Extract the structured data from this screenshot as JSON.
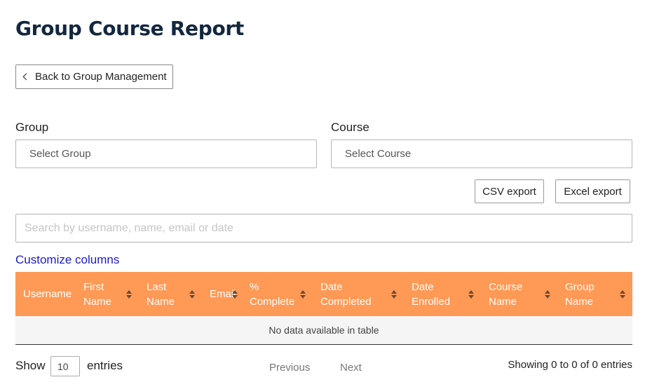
{
  "page": {
    "title": "Group Course Report"
  },
  "back_button": {
    "label": "Back to Group Management"
  },
  "filters": {
    "group": {
      "label": "Group",
      "value": "Select Group"
    },
    "course": {
      "label": "Course",
      "value": "Select Course"
    }
  },
  "exports": {
    "csv_label": "CSV export",
    "excel_label": "Excel export"
  },
  "search": {
    "placeholder": "Search by username, name, email or date"
  },
  "customize": {
    "label": "Customize columns"
  },
  "table": {
    "columns": [
      {
        "line1": "Username",
        "line2": ""
      },
      {
        "line1": "First",
        "line2": "Name"
      },
      {
        "line1": "Last",
        "line2": "Name"
      },
      {
        "line1": "Email",
        "line2": ""
      },
      {
        "line1": "%",
        "line2": "Complete"
      },
      {
        "line1": "Date",
        "line2": "Completed"
      },
      {
        "line1": "Date",
        "line2": "Enrolled"
      },
      {
        "line1": "Course",
        "line2": "Name"
      },
      {
        "line1": "Group",
        "line2": "Name"
      }
    ],
    "empty_message": "No data available in table",
    "header_color": "#ff9955"
  },
  "footer": {
    "show_label": "Show",
    "page_length": "10",
    "entries_label": "entries",
    "previous_label": "Previous",
    "next_label": "Next",
    "info": "Showing 0 to 0 of 0 entries"
  }
}
